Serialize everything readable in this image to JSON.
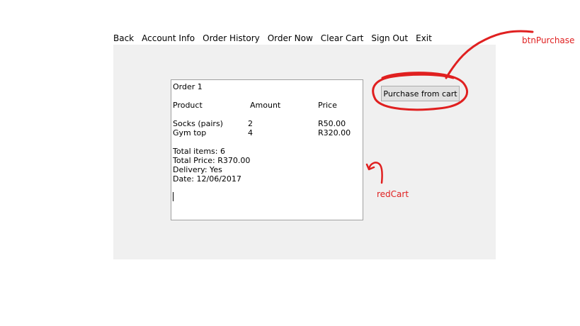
{
  "menu": [
    {
      "label": "Back"
    },
    {
      "label": "Account Info"
    },
    {
      "label": "Order History"
    },
    {
      "label": "Order Now"
    },
    {
      "label": "Clear Cart"
    },
    {
      "label": "Sign Out"
    },
    {
      "label": "Exit"
    }
  ],
  "cart": {
    "order_title": "Order 1",
    "headers": {
      "product": "Product",
      "amount": "Amount",
      "price": "Price"
    },
    "items": [
      {
        "product": "Socks (pairs)",
        "amount": "2",
        "price": "R50.00"
      },
      {
        "product": "Gym top",
        "amount": "4",
        "price": "R320.00"
      }
    ],
    "total_items": "Total items: 6",
    "total_price": "Total Price: R370.00",
    "delivery": "Delivery: Yes",
    "date": "Date: 12/06/2017"
  },
  "button": {
    "label": "Purchase from cart"
  },
  "annotations": {
    "btn_label": "btnPurchase",
    "red_label": "redCart",
    "color": "#e02020"
  }
}
